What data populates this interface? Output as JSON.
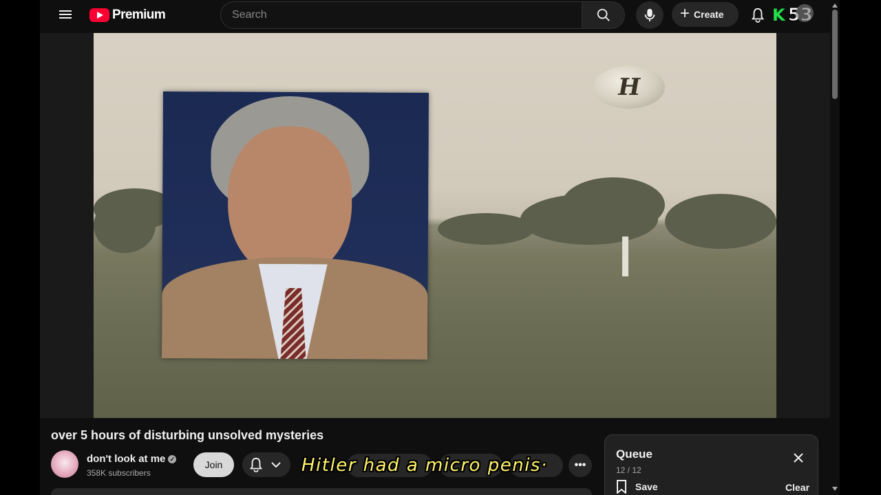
{
  "header": {
    "logo_text": "Premium",
    "search_placeholder": "Search",
    "create_label": "Create",
    "badge_letter": "K",
    "badge_number": "53"
  },
  "video": {
    "ufo_glyph": "H"
  },
  "subtitle": "Hitler had a micro penis·",
  "details": {
    "title": "over 5 hours of disturbing unsolved mysteries",
    "channel_name": "don't look at me",
    "subscribers": "358K subscribers",
    "join_label": "Join",
    "more_label": "•••"
  },
  "queue": {
    "title": "Queue",
    "count": "12 / 12",
    "save_label": "Save",
    "clear_label": "Clear"
  },
  "colors": {
    "brand_red": "#ff0033",
    "subtitle_yellow": "#fff36a",
    "badge_green": "#22e04a"
  },
  "icons": [
    "menu-icon",
    "youtube-logo-icon",
    "search-icon",
    "mic-icon",
    "plus-icon",
    "bell-icon",
    "verified-icon",
    "chevron-down-icon",
    "close-icon",
    "bookmark-icon"
  ]
}
